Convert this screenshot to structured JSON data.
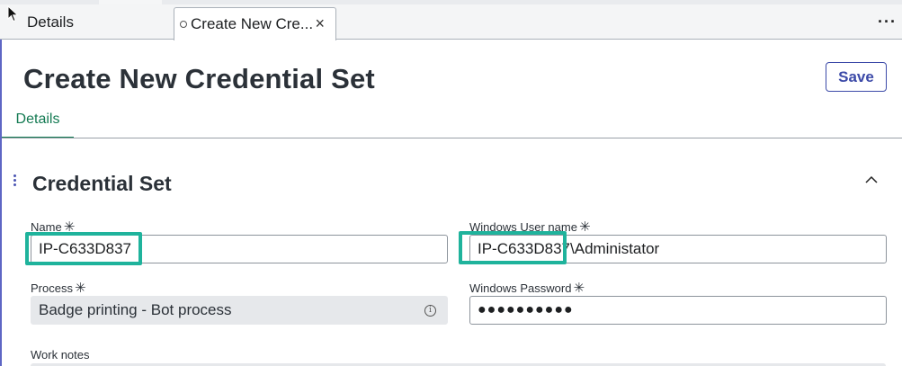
{
  "tabs": {
    "details_label": "Details",
    "active_label": "Create New Cre...",
    "close_glyph": "×",
    "more_glyph": "···"
  },
  "page": {
    "title": "Create New Credential Set",
    "save_label": "Save"
  },
  "subtabs": {
    "details_label": "Details"
  },
  "section": {
    "title": "Credential Set",
    "collapse_icon": "chevron-up-icon"
  },
  "fields": {
    "name": {
      "label": "Name",
      "required_mark": "✳",
      "value": "IP-C633D837"
    },
    "windows_user": {
      "label": "Windows User name",
      "required_mark": "✳",
      "value": "IP-C633D837\\Administator"
    },
    "process": {
      "label": "Process",
      "required_mark": "✳",
      "value": "Badge printing - Bot process",
      "info_glyph": "i"
    },
    "windows_password": {
      "label": "Windows Password",
      "required_mark": "✳",
      "value": "●●●●●●●●●●"
    },
    "work_notes": {
      "label": "Work notes"
    }
  },
  "colors": {
    "accent": "#3c4aa8",
    "subtab_active": "#137a52",
    "highlight": "#1fb39c"
  }
}
